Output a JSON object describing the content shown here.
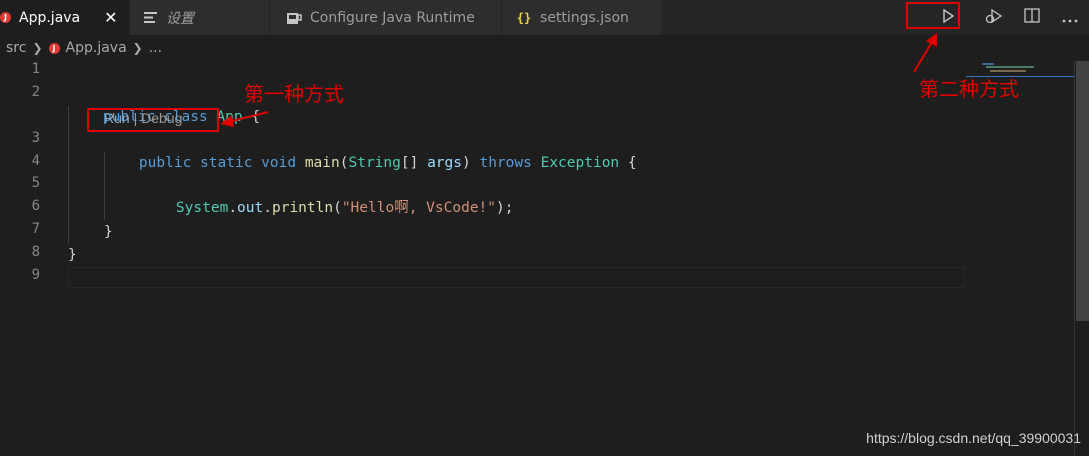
{
  "tabs": [
    {
      "label": "App.java",
      "icon": "java-file-icon",
      "active": true,
      "close": "✕"
    },
    {
      "label": "设置",
      "icon": "settings-file-icon",
      "active": false
    },
    {
      "label": "Configure Java Runtime",
      "icon": "java-runtime-icon",
      "active": false
    },
    {
      "label": "settings.json",
      "icon": "json-braces-icon",
      "active": false
    }
  ],
  "actions": [
    "run-icon",
    "run-debug-icon",
    "split-editor-icon",
    "more-actions-icon"
  ],
  "breadcrumb": {
    "folder": "src",
    "file": "App.java",
    "tail": "..."
  },
  "line_numbers": [
    "1",
    "2",
    "3",
    "4",
    "5",
    "6",
    "7",
    "8",
    "9"
  ],
  "code": {
    "l2": {
      "kw1": "public",
      "kw2": "class",
      "name": "App",
      "brace": " {"
    },
    "lens": {
      "run": "Run",
      "sep": " | ",
      "debug": "Debug"
    },
    "l3": {
      "kw1": "public",
      "kw2": "static",
      "kw3": "void",
      "fn": "main",
      "p1": "(",
      "type": "String",
      "p2": "[] ",
      "arg": "args",
      "p3": ") ",
      "kw4": "throws",
      "exc": "Exception",
      "brace": " {"
    },
    "l5": {
      "obj": "System",
      "dot1": ".",
      "field": "out",
      "dot2": ".",
      "fn": "println",
      "p1": "(",
      "str": "\"Hello啊, VsCode!\"",
      "p2": ");"
    },
    "l7": "}",
    "l8": "}"
  },
  "annotations": {
    "method1": "第一种方式",
    "method2": "第二种方式"
  },
  "watermark": "https://blog.csdn.net/qq_39900031",
  "colors": {
    "annotation": "#e00000",
    "keyword": "#569cd6",
    "class": "#4ec9b0",
    "function": "#dcdcaa",
    "variable": "#9cdcfe",
    "string": "#ce9178"
  }
}
